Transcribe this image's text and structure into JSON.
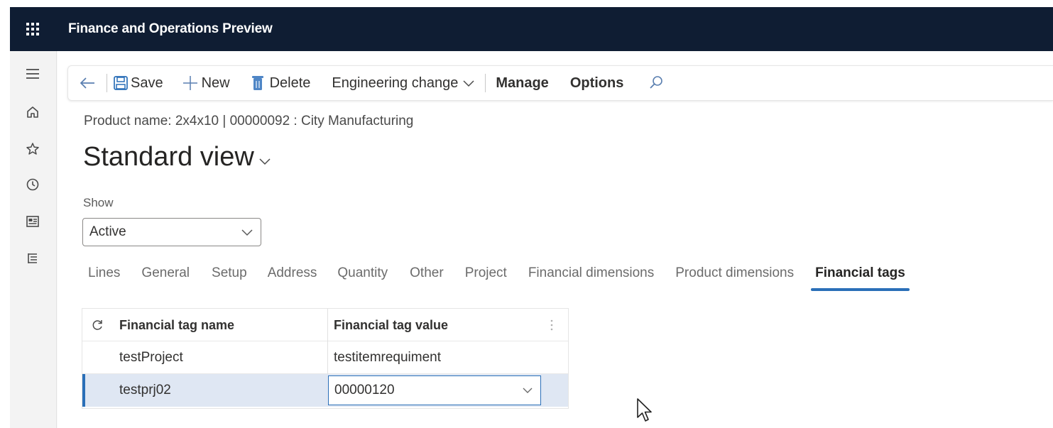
{
  "app": {
    "title": "Finance and Operations Preview"
  },
  "toolbar": {
    "save_label": "Save",
    "new_label": "New",
    "delete_label": "Delete",
    "engineering_change_label": "Engineering change",
    "manage_label": "Manage",
    "options_label": "Options"
  },
  "header": {
    "subtitle": "Product name: 2x4x10  |  00000092 : City Manufacturing",
    "title": "Standard view"
  },
  "filter": {
    "show_label": "Show",
    "show_value": "Active"
  },
  "tabs": [
    {
      "label": "Lines",
      "active": false
    },
    {
      "label": "General",
      "active": false
    },
    {
      "label": "Setup",
      "active": false
    },
    {
      "label": "Address",
      "active": false
    },
    {
      "label": "Quantity",
      "active": false
    },
    {
      "label": "Other",
      "active": false
    },
    {
      "label": "Project",
      "active": false
    },
    {
      "label": "Financial dimensions",
      "active": false
    },
    {
      "label": "Product dimensions",
      "active": false
    },
    {
      "label": "Financial tags",
      "active": true
    }
  ],
  "grid": {
    "columns": [
      "Financial tag name",
      "Financial tag value"
    ],
    "rows": [
      {
        "name": "testProject",
        "value": "testitemrequiment"
      },
      {
        "name": "testprj02",
        "value": "00000120"
      }
    ]
  },
  "icons": {
    "app_launcher": "waffle-icon",
    "nav": [
      "hamburger-icon",
      "home-icon",
      "star-icon",
      "clock-icon",
      "workspace-icon",
      "list-icon"
    ],
    "toolbar": [
      "back-arrow-icon",
      "save-icon",
      "plus-icon",
      "delete-icon",
      "chevron-down-icon",
      "search-icon"
    ],
    "grid": [
      "refresh-icon",
      "column-options-icon"
    ]
  },
  "colors": {
    "topbar": "#0f1d33",
    "accent": "#2a6fb8",
    "selected_row": "#dfe7f3"
  }
}
